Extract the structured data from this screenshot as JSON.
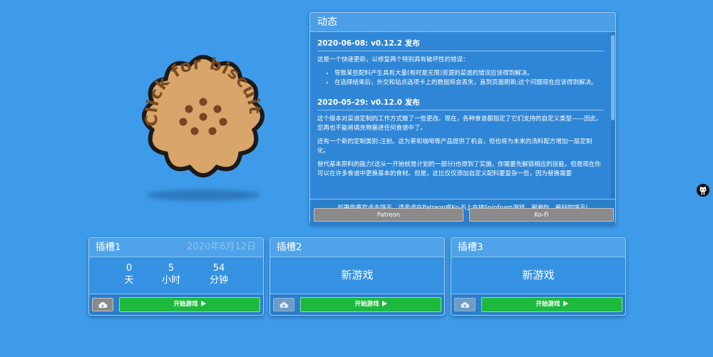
{
  "biscuit": {
    "label": "Click for biscuits"
  },
  "news": {
    "title": "动态",
    "posts": [
      {
        "heading": "2020-06-08: v0.12.2 发布",
        "intro": "这是一个快速更新，以修复两个特别具有破坏性的错误：",
        "bullets": [
          "导致某些配料产生具有大量(有时是无限)资源的菜谱的错误应该得到解决。",
          "在选择结束后，外交和站点选项卡上的数据将会丢失，直到页面刷新;这个问题现在应该得到解决。"
        ]
      },
      {
        "heading": "2020-05-29: v0.12.0 发布",
        "paragraphs": [
          "这个版本对菜谱定制的工作方式做了一些更改。现在，各种食谱都指定了它们支持的自定义类型——因此，您再也不能将填充物塞进任何食谱中了。",
          "还有一个新的定制类别:注射。这为茶和咖啡等产品提供了机会，但也将为未来的汤料配方增加一层定制化。",
          "替代基本原料的能力(这从一开始就是计划的一部分)也得到了实施。你需要先解锁相应的技能，但是现在你可以在许多食谱中更换基本的食材。但是，这比仅仅添加自定义配料要复杂一些，因为替换需要"
        ]
      }
    ],
    "support_text": "如果你喜欢点击饼干，请考虑在Patreon或Ko-Fi上支持Spinfoam游戏。谢谢你，最好的饼干!",
    "patreon_label": "Patreon",
    "kofi_label": "Ko-Fi"
  },
  "slots": [
    {
      "title": "插槽1",
      "date": "2020年6月12日",
      "days": "0",
      "days_label": "天",
      "hours": "5",
      "hours_label": "小时",
      "minutes": "54",
      "minutes_label": "分钟",
      "start_label": "开始游戏"
    },
    {
      "title": "插槽2",
      "empty_label": "新游戏",
      "start_label": "开始游戏"
    },
    {
      "title": "插槽3",
      "empty_label": "新游戏",
      "start_label": "开始游戏"
    }
  ],
  "colors": {
    "background": "#3d9be9",
    "biscuit_fill": "#d8a56a",
    "start_green": "#1db93c"
  },
  "icons": {
    "cloud": "cloud-download-icon",
    "play": "play-triangle-icon",
    "github": "github-octocat-icon"
  }
}
